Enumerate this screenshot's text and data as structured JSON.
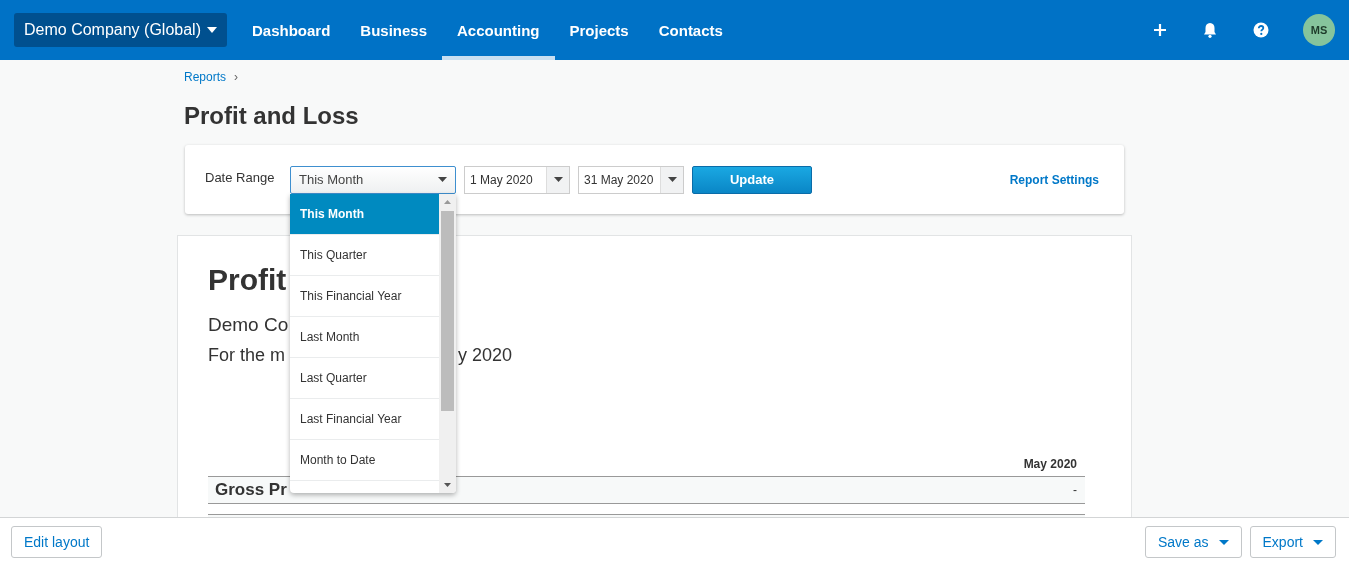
{
  "top_nav": {
    "org_switcher": "Demo Company (Global)",
    "tabs": [
      {
        "label": "Dashboard",
        "selected": false
      },
      {
        "label": "Business",
        "selected": false
      },
      {
        "label": "Accounting",
        "selected": true
      },
      {
        "label": "Projects",
        "selected": false
      },
      {
        "label": "Contacts",
        "selected": false
      }
    ],
    "avatar": "MS"
  },
  "breadcrumb": {
    "link": "Reports",
    "separator": "›"
  },
  "page_title": "Profit and Loss",
  "filters": {
    "label": "Date Range",
    "range_select": {
      "value": "This Month",
      "expanded": true
    },
    "from_date": "1 May 2020",
    "to_date": "31 May 2020",
    "update_button": "Update",
    "settings_link": "Report Settings"
  },
  "range_options": [
    {
      "label": "This Month",
      "selected": true
    },
    {
      "label": "This Quarter",
      "selected": false
    },
    {
      "label": "This Financial Year",
      "selected": false
    },
    {
      "label": "Last Month",
      "selected": false
    },
    {
      "label": "Last Quarter",
      "selected": false
    },
    {
      "label": "Last Financial Year",
      "selected": false
    },
    {
      "label": "Month to Date",
      "selected": false
    }
  ],
  "report": {
    "title": "Profit",
    "company": "Demo Co",
    "period_start": "For the m",
    "period_end": "y 2020",
    "column_heading": "May 2020",
    "rows": [
      {
        "label": "Gross Pr",
        "value": "-"
      },
      {}
    ]
  },
  "footer": {
    "edit_button": "Edit layout",
    "save_button": "Save as",
    "export_button": "Export"
  }
}
